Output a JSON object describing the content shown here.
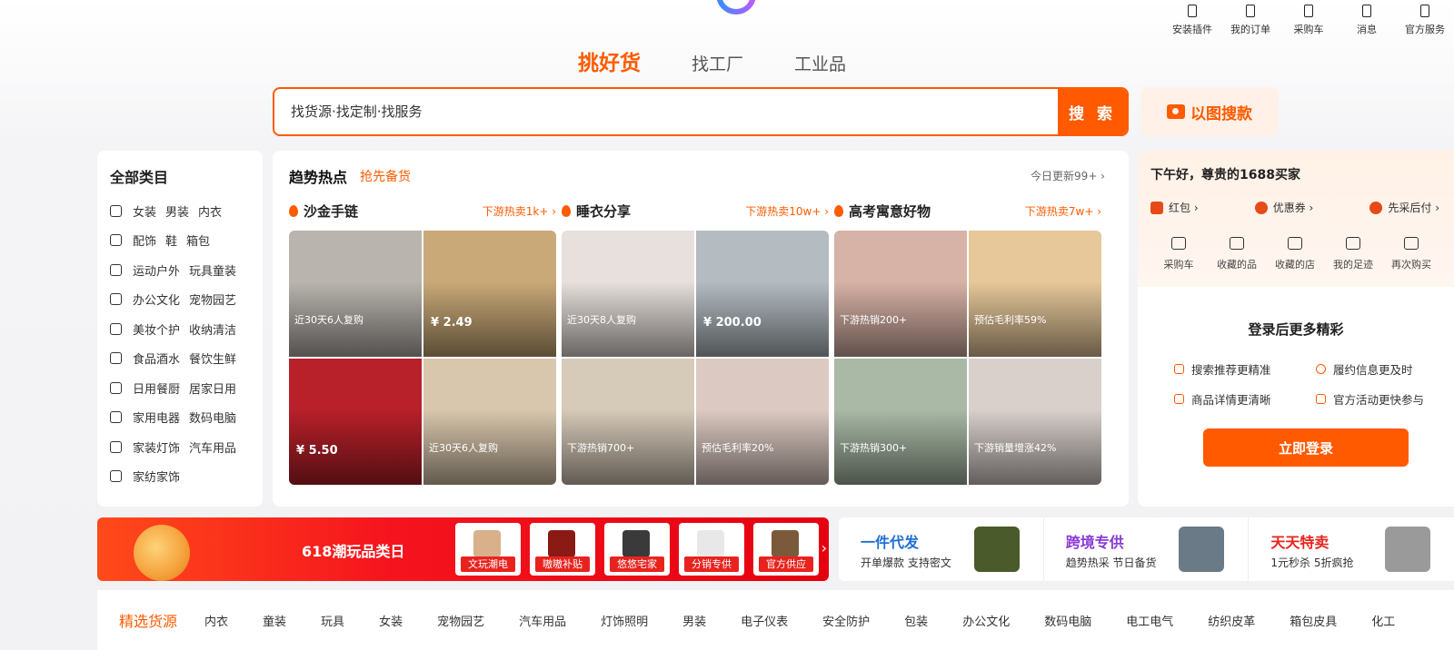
{
  "utility_bar": [
    {
      "label": "安装插件",
      "icon": "plugin-icon"
    },
    {
      "label": "我的订单",
      "icon": "order-icon"
    },
    {
      "label": "采购车",
      "icon": "cart-icon"
    },
    {
      "label": "消息",
      "icon": "message-icon"
    },
    {
      "label": "官方服务",
      "icon": "service-icon"
    }
  ],
  "channel_tabs": [
    "挑好货",
    "找工厂",
    "工业品"
  ],
  "search": {
    "placeholder": "找货源·找定制·找服务",
    "button": "搜 索",
    "image_search": "以图搜款"
  },
  "categories": {
    "title": "全部类目",
    "rows": [
      {
        "icon": "shirt-icon",
        "items": [
          "女装",
          "男装",
          "内衣"
        ]
      },
      {
        "icon": "shoe-icon",
        "items": [
          "配饰",
          "鞋",
          "箱包"
        ]
      },
      {
        "icon": "tent-icon",
        "items": [
          "运动户外",
          "玩具童装"
        ]
      },
      {
        "icon": "briefcase-icon",
        "items": [
          "办公文化",
          "宠物园艺"
        ]
      },
      {
        "icon": "cosmetics-icon",
        "items": [
          "美妆个护",
          "收纳清洁"
        ]
      },
      {
        "icon": "apple-icon",
        "items": [
          "食品酒水",
          "餐饮生鲜"
        ]
      },
      {
        "icon": "cabinet-icon",
        "items": [
          "日用餐厨",
          "居家日用"
        ]
      },
      {
        "icon": "camera-icon",
        "items": [
          "家用电器",
          "数码电脑"
        ]
      },
      {
        "icon": "bulb-icon",
        "items": [
          "家装灯饰",
          "汽车用品"
        ]
      },
      {
        "icon": "bed-icon",
        "items": [
          "家纺家饰"
        ]
      }
    ]
  },
  "trending": {
    "title": "趋势热点",
    "subtitle": "抢先备货",
    "update": "今日更新99+ ›",
    "columns": [
      {
        "name": "沙金手链",
        "hot": "下游热卖1k+ ›",
        "tiles": [
          {
            "note": "近30天6人复购",
            "price": "",
            "color": "#b9b4ae"
          },
          {
            "note": "",
            "price": "¥ 2.49",
            "color": "#c9a978"
          },
          {
            "note": "",
            "price": "¥ 5.50",
            "color": "#b8202a"
          },
          {
            "note": "近30天6人复购",
            "price": "",
            "color": "#d9c7ad"
          }
        ]
      },
      {
        "name": "睡衣分享",
        "hot": "下游热卖10w+ ›",
        "tiles": [
          {
            "note": "近30天8人复购",
            "price": "",
            "color": "#e7e0dc"
          },
          {
            "note": "",
            "price": "¥ 200.00",
            "color": "#b4bcc2"
          },
          {
            "note": "下游热销700+",
            "price": "",
            "color": "#d6cab9"
          },
          {
            "note": "预估毛利率20%",
            "price": "",
            "color": "#dccac2"
          }
        ]
      },
      {
        "name": "高考寓意好物",
        "hot": "下游热卖7w+ ›",
        "tiles": [
          {
            "note": "下游热销200+",
            "price": "",
            "color": "#d7b2a6"
          },
          {
            "note": "预估毛利率59%",
            "price": "",
            "color": "#e6c89a"
          },
          {
            "note": "下游热销300+",
            "price": "",
            "color": "#a9b9a6"
          },
          {
            "note": "下游销量增涨42%",
            "price": "",
            "color": "#d9d0cc"
          }
        ]
      }
    ]
  },
  "user_panel": {
    "greeting": "下午好，尊贵的1688买家",
    "perks": [
      "红包 ›",
      "优惠券 ›",
      "先采后付 ›"
    ],
    "quick_links": [
      {
        "label": "采购车",
        "icon": "cart-icon"
      },
      {
        "label": "收藏的品",
        "icon": "star-icon"
      },
      {
        "label": "收藏的店",
        "icon": "shop-icon"
      },
      {
        "label": "我的足迹",
        "icon": "footprint-icon"
      },
      {
        "label": "再次购买",
        "icon": "rebuy-icon"
      }
    ],
    "login_heading": "登录后更多精彩",
    "benefits": [
      "搜索推荐更精准",
      "履约信息更及时",
      "商品详情更清晰",
      "官方活动更快参与"
    ],
    "login_button": "立即登录"
  },
  "promo_banner": {
    "title": "618潮玩品类日",
    "items": [
      {
        "label": "文玩潮电",
        "color": "#d8b08a"
      },
      {
        "label": "嗷嗷补贴",
        "color": "#8a1a14"
      },
      {
        "label": "悠悠宅家",
        "color": "#3a3a3a"
      },
      {
        "label": "分销专供",
        "color": "#e8e8e8"
      },
      {
        "label": "官方供应",
        "color": "#7a5a3a"
      }
    ]
  },
  "services": [
    {
      "title": "一件代发",
      "desc": "开单爆款 支持密文",
      "title_color": "#1f6fd1",
      "img_color": "#4a5a2a"
    },
    {
      "title": "跨境专供",
      "desc": "趋势热采 节日备货",
      "title_color": "#8a3bd6",
      "img_color": "#6a7a86"
    },
    {
      "title": "天天特卖",
      "desc": "1元秒杀 5折疯抢",
      "title_color": "#e8231e",
      "img_color": "#9a9a9a"
    }
  ],
  "source_tabs": [
    "精选货源",
    "内衣",
    "童装",
    "玩具",
    "女装",
    "宠物园艺",
    "汽车用品",
    "灯饰照明",
    "男装",
    "电子仪表",
    "安全防护",
    "包装",
    "办公文化",
    "数码电脑",
    "电工电气",
    "纺织皮革",
    "箱包皮具",
    "化工"
  ],
  "colors": {
    "accent": "#ff5a00",
    "promo_red": "#e8231e"
  }
}
